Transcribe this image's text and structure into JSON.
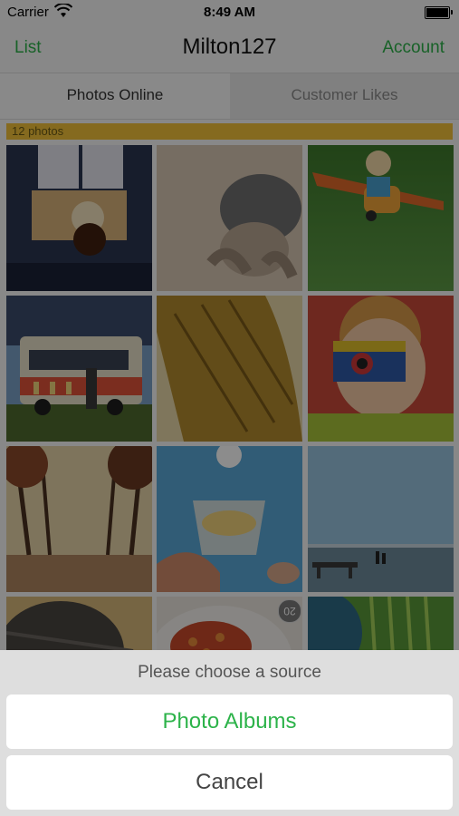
{
  "status_bar": {
    "carrier": "Carrier",
    "time": "8:49 AM",
    "wifi_icon": "wifi-icon",
    "battery_icon": "battery-icon"
  },
  "nav": {
    "left": "List",
    "title": "Milton127",
    "right": "Account"
  },
  "tabs": [
    {
      "label": "Photos Online",
      "selected": true
    },
    {
      "label": "Customer Likes",
      "selected": false
    }
  ],
  "photo_count_label": "12 photos",
  "photos": [
    {
      "subject": "child silhouette at window"
    },
    {
      "subject": "child covering face"
    },
    {
      "subject": "child on toy airplane on grass"
    },
    {
      "subject": "ice cream truck"
    },
    {
      "subject": "lizard close-up"
    },
    {
      "subject": "child holding lego camera"
    },
    {
      "subject": "autumn tree avenue"
    },
    {
      "subject": "hand holding glass of water"
    },
    {
      "subject": "pier and sea"
    },
    {
      "subject": "animal fur"
    },
    {
      "subject": "bowl of food",
      "badge": "20"
    },
    {
      "subject": "green leaf"
    }
  ],
  "action_sheet": {
    "prompt": "Please choose a source",
    "buttons": [
      {
        "label": "Photo Albums"
      },
      {
        "label": "Cancel"
      }
    ]
  },
  "colors": {
    "accent": "#2db34a",
    "count_bar": "#f2c23a"
  }
}
